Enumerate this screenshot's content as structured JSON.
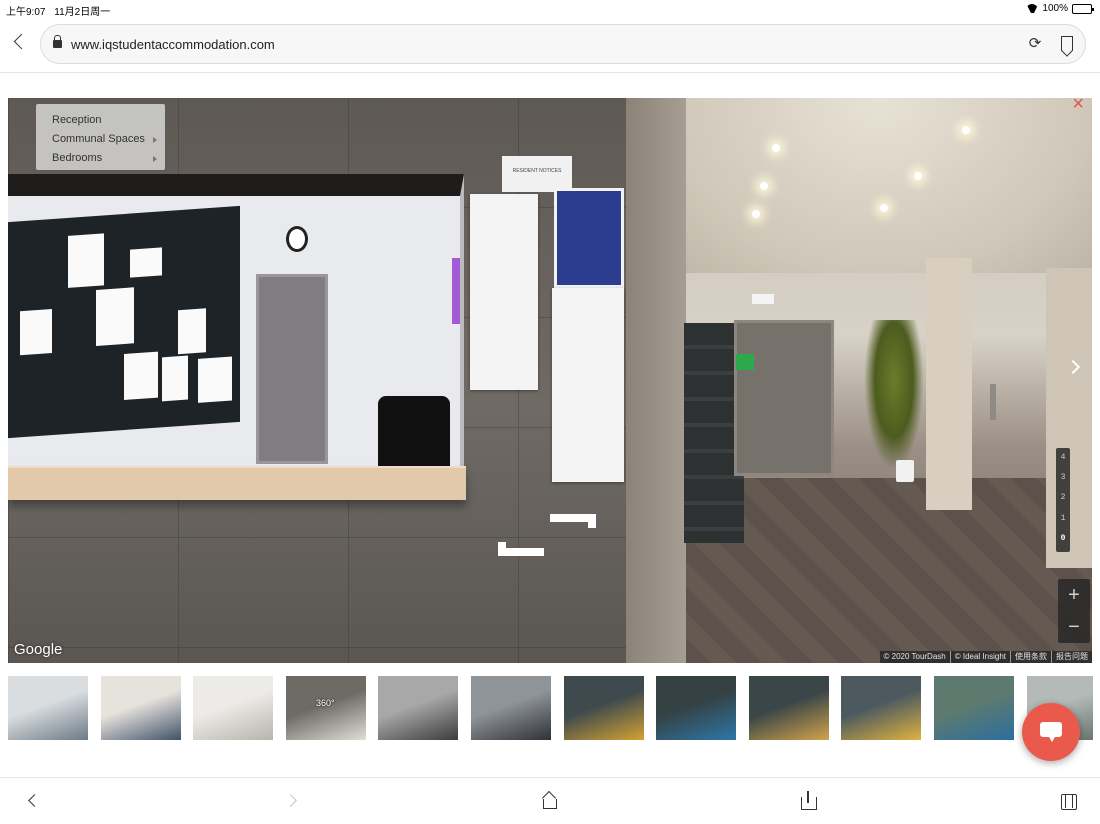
{
  "status_bar": {
    "time": "上午9:07",
    "date": "11月2日周一",
    "battery": "100%",
    "battery_level": 1.0,
    "battery_color": "#2ecc40"
  },
  "browser": {
    "url": "www.iqstudentaccommodation.com",
    "icons": {
      "back": "chevron-left-icon",
      "lock": "lock-icon",
      "reload": "reload-icon",
      "bookmark": "bookmark-icon"
    }
  },
  "tour": {
    "menu": [
      {
        "label": "Reception",
        "has_submenu": false
      },
      {
        "label": "Communal Spaces",
        "has_submenu": true
      },
      {
        "label": "Bedrooms",
        "has_submenu": true
      }
    ],
    "close_icon": "×",
    "close_color": "#e0554a",
    "floors": [
      "4",
      "3",
      "2",
      "1",
      "0"
    ],
    "active_floor": "0",
    "zoom_in": "+",
    "zoom_out": "−",
    "google_logo": "Google",
    "attribution": [
      "© 2020 TourDash",
      "© Ideal Insight",
      "使用条款",
      "报告问题"
    ],
    "signage": {
      "resident_notices": "RESIDENT NOTICES"
    }
  },
  "thumbnails": [
    {
      "scene": "bedroom-1",
      "is_360": false,
      "colors": [
        "#d9dde0",
        "#6d7a85"
      ]
    },
    {
      "scene": "bedroom-2",
      "is_360": false,
      "colors": [
        "#e6e2dc",
        "#41526a"
      ]
    },
    {
      "scene": "bathroom",
      "is_360": false,
      "colors": [
        "#ecebe7",
        "#b8b4ad"
      ]
    },
    {
      "scene": "reception",
      "is_360": true,
      "label": "360°",
      "colors": [
        "#6e6a64",
        "#e0ded6"
      ]
    },
    {
      "scene": "gym-1",
      "is_360": false,
      "colors": [
        "#a8a8a8",
        "#3c3c3c"
      ]
    },
    {
      "scene": "gym-2",
      "is_360": false,
      "colors": [
        "#8f9498",
        "#2f3236"
      ]
    },
    {
      "scene": "lounge-1",
      "is_360": false,
      "colors": [
        "#3e4a4e",
        "#d4a232"
      ]
    },
    {
      "scene": "lounge-2",
      "is_360": false,
      "colors": [
        "#344244",
        "#2e77a8"
      ]
    },
    {
      "scene": "lounge-3",
      "is_360": false,
      "colors": [
        "#3a4648",
        "#d3a34a"
      ]
    },
    {
      "scene": "lounge-4",
      "is_360": false,
      "colors": [
        "#4c5a60",
        "#e0b240"
      ]
    },
    {
      "scene": "study-1",
      "is_360": false,
      "colors": [
        "#5e7a6e",
        "#2b6f9f"
      ]
    },
    {
      "scene": "study-2",
      "is_360": false,
      "colors": [
        "#b4bab8",
        "#6a7672"
      ]
    }
  ],
  "chat": {
    "icon": "chat-bubble-icon",
    "color": "#e95a4c"
  },
  "toolbar": {
    "back_icon": "chevron-left-icon",
    "forward_icon": "chevron-right-icon",
    "home_icon": "home-icon",
    "share_icon": "share-icon",
    "tabs_icon": "tabs-icon"
  }
}
